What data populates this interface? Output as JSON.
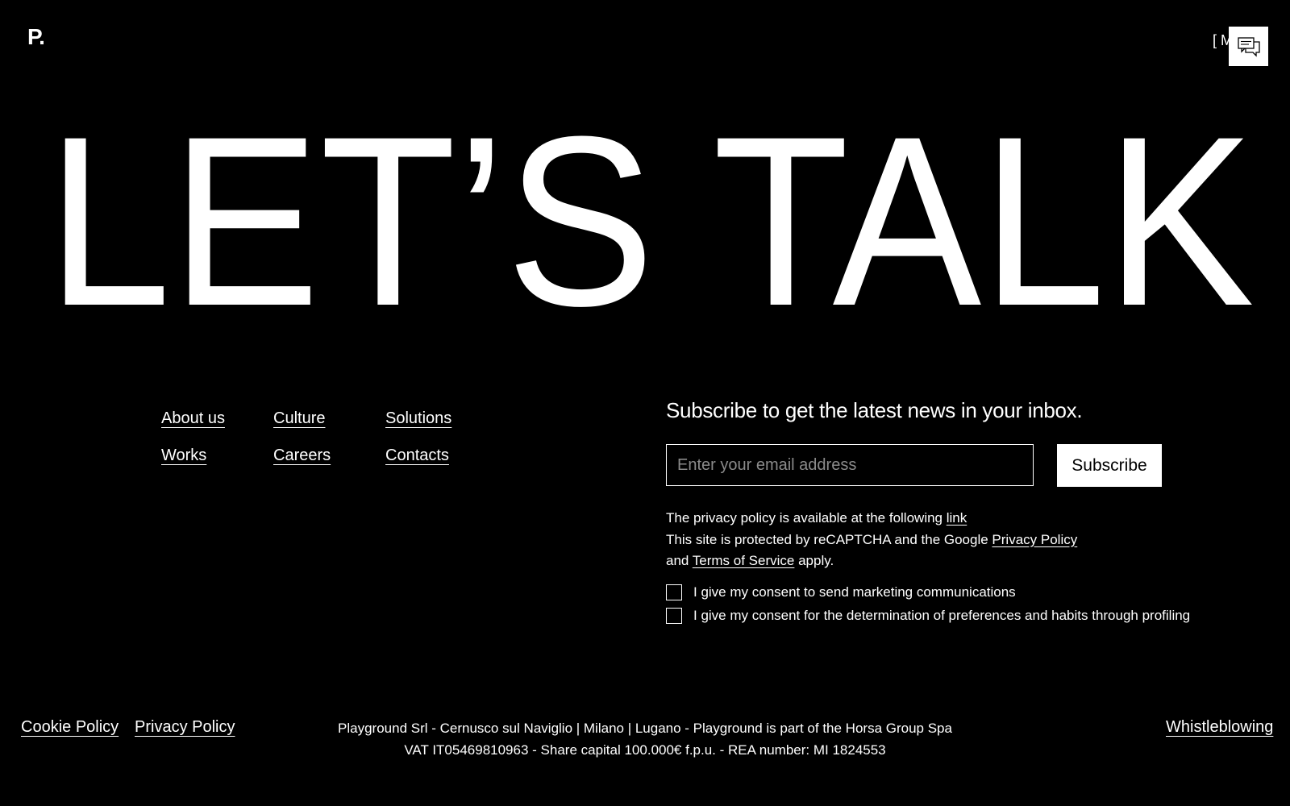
{
  "header": {
    "logo_text": "P.",
    "menu_label": "[ M",
    "chat_icon": "chat-icon"
  },
  "hero": {
    "title": "LET’S TALK"
  },
  "nav": {
    "items": [
      {
        "label": "About us"
      },
      {
        "label": "Culture"
      },
      {
        "label": "Solutions"
      },
      {
        "label": "Works"
      },
      {
        "label": "Careers"
      },
      {
        "label": "Contacts"
      }
    ]
  },
  "subscribe": {
    "title": "Subscribe to get the latest news in your inbox.",
    "email_placeholder": "Enter your email address",
    "email_value": "",
    "button_label": "Subscribe"
  },
  "privacy": {
    "line1_text": "The privacy policy is available at the following ",
    "line1_link": "link",
    "line2_text": "This site is protected by reCAPTCHA and the Google ",
    "line2_link": "Privacy Policy",
    "line3_prefix": "and ",
    "line3_link": "Terms of Service",
    "line3_suffix": " apply."
  },
  "consents": [
    {
      "label": "I give my consent to send marketing communications",
      "checked": false
    },
    {
      "label": "I give my consent for the determination of preferences and habits through profiling",
      "checked": false
    }
  ],
  "footer": {
    "cookie_policy": "Cookie Policy",
    "privacy_policy": "Privacy Policy",
    "company_line1": "Playground Srl - Cernusco sul Naviglio | Milano | Lugano - Playground is part of the Horsa Group Spa",
    "company_line2": "VAT IT05469810963 - Share capital 100.000€ f.p.u. - REA number: MI 1824553",
    "whistleblowing": "Whistleblowing"
  },
  "colors": {
    "background": "#000000",
    "foreground": "#ffffff",
    "placeholder": "#8a8a8a"
  }
}
